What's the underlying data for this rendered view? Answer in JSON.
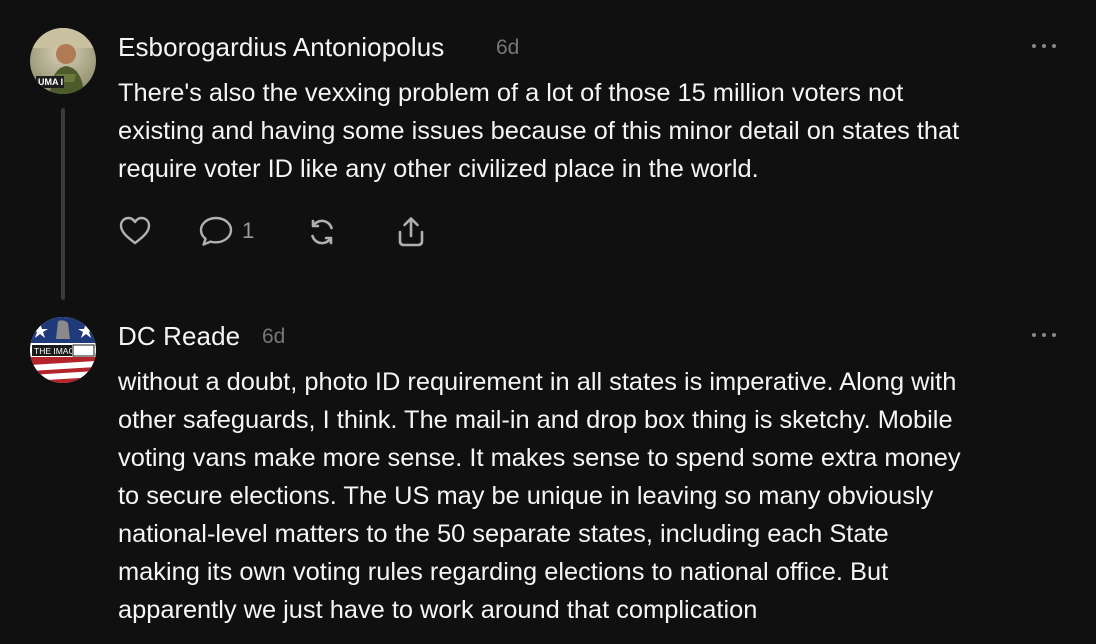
{
  "posts": [
    {
      "author": "Esborogardius Antoniopolus",
      "time": "6d",
      "avatar_badge": "UMA I",
      "lines": [
        "There's also the vexxing problem of a lot of those 15 million voters not",
        "existing and having some issues because of this minor detail on states that",
        "require voter ID like any other civilized place in the world."
      ],
      "actions": {
        "like_icon": "heart-icon",
        "reply_icon": "comment-icon",
        "reply_count": "1",
        "repost_icon": "repost-icon",
        "share_icon": "share-icon"
      }
    },
    {
      "author": "DC Reade",
      "time": "6d",
      "avatar_badge": "THE IMAGE",
      "lines": [
        "without a doubt, photo ID requirement in all states is imperative. Along with",
        "other safeguards, I think. The mail-in and drop box thing is sketchy. Mobile",
        "voting vans make more sense. It makes sense to spend some extra money",
        "to secure elections. The US may be unique in leaving so many obviously",
        "national-level matters to the 50 separate states, including each State",
        "making its own voting rules regarding elections to national office. But",
        "apparently we just have to work around that complication"
      ]
    }
  ],
  "colors": {
    "background": "#101010",
    "text": "#f3f5f7",
    "muted": "#777777",
    "icon": "#b0b0b0",
    "thread_line": "#3a3a3a"
  }
}
